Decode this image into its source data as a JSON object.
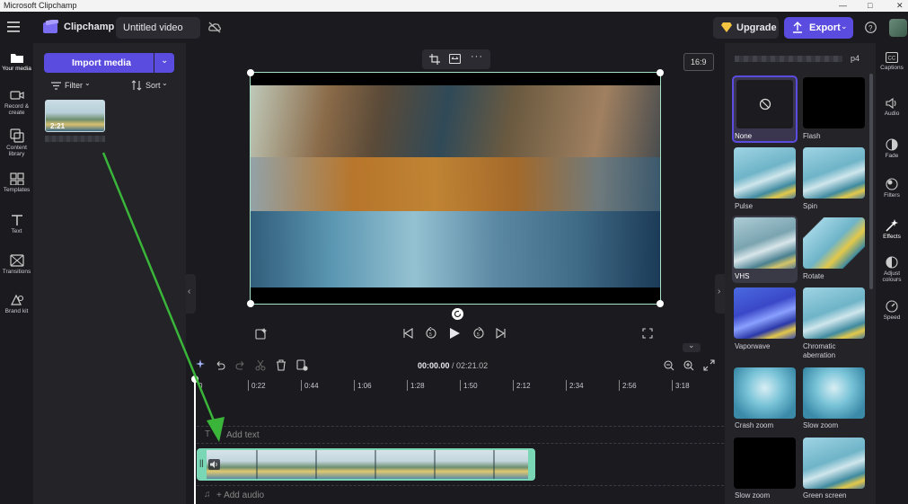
{
  "window": {
    "title": "Microsoft Clipchamp"
  },
  "appbar": {
    "brand": "Clipchamp",
    "project_title": "Untitled video",
    "upgrade_label": "Upgrade",
    "export_label": "Export"
  },
  "left_rail": {
    "items": [
      {
        "label": "Your media",
        "icon": "folder-icon"
      },
      {
        "label": "Record & create",
        "icon": "camera-icon"
      },
      {
        "label": "Content library",
        "icon": "library-icon"
      },
      {
        "label": "Templates",
        "icon": "templates-icon"
      },
      {
        "label": "Text",
        "icon": "text-icon"
      },
      {
        "label": "Transitions",
        "icon": "transitions-icon"
      },
      {
        "label": "Brand kit",
        "icon": "brand-kit-icon"
      }
    ]
  },
  "media": {
    "import_label": "Import media",
    "filter_label": "Filter",
    "sort_label": "Sort",
    "thumb_duration": "2:21"
  },
  "preview": {
    "aspect_ratio": "16:9"
  },
  "timeline": {
    "current_time": "00:00.00",
    "total_time": "/ 02:21.02",
    "ticks": [
      "0",
      "0:22",
      "0:44",
      "1:06",
      "1:28",
      "1:50",
      "2:12",
      "2:34",
      "2:56",
      "3:18"
    ],
    "add_text_label": "Add text",
    "add_audio_label": "+ Add audio"
  },
  "effects_panel": {
    "file_suffix": "p4",
    "items": [
      {
        "label": "None",
        "selected": true
      },
      {
        "label": "Flash"
      },
      {
        "label": "Pulse"
      },
      {
        "label": "Spin"
      },
      {
        "label": "VHS",
        "highlight": true
      },
      {
        "label": "Rotate"
      },
      {
        "label": "Vaporwave"
      },
      {
        "label": "Chromatic aberration"
      },
      {
        "label": "Crash zoom"
      },
      {
        "label": "Slow zoom"
      },
      {
        "label": "Slow zoom"
      },
      {
        "label": "Green screen"
      }
    ]
  },
  "right_rail": {
    "items": [
      {
        "label": "Captions",
        "icon": "captions-icon"
      },
      {
        "label": "Audio",
        "icon": "speaker-icon"
      },
      {
        "label": "Fade",
        "icon": "fade-icon"
      },
      {
        "label": "Filters",
        "icon": "filters-icon"
      },
      {
        "label": "Effects",
        "icon": "effects-icon",
        "active": true
      },
      {
        "label": "Adjust colours",
        "icon": "adjust-colours-icon"
      },
      {
        "label": "Speed",
        "icon": "speed-icon"
      }
    ]
  },
  "colors": {
    "accent": "#5b4ce0",
    "selection": "#a7e3c7",
    "clip_border": "#7ad7b6"
  }
}
